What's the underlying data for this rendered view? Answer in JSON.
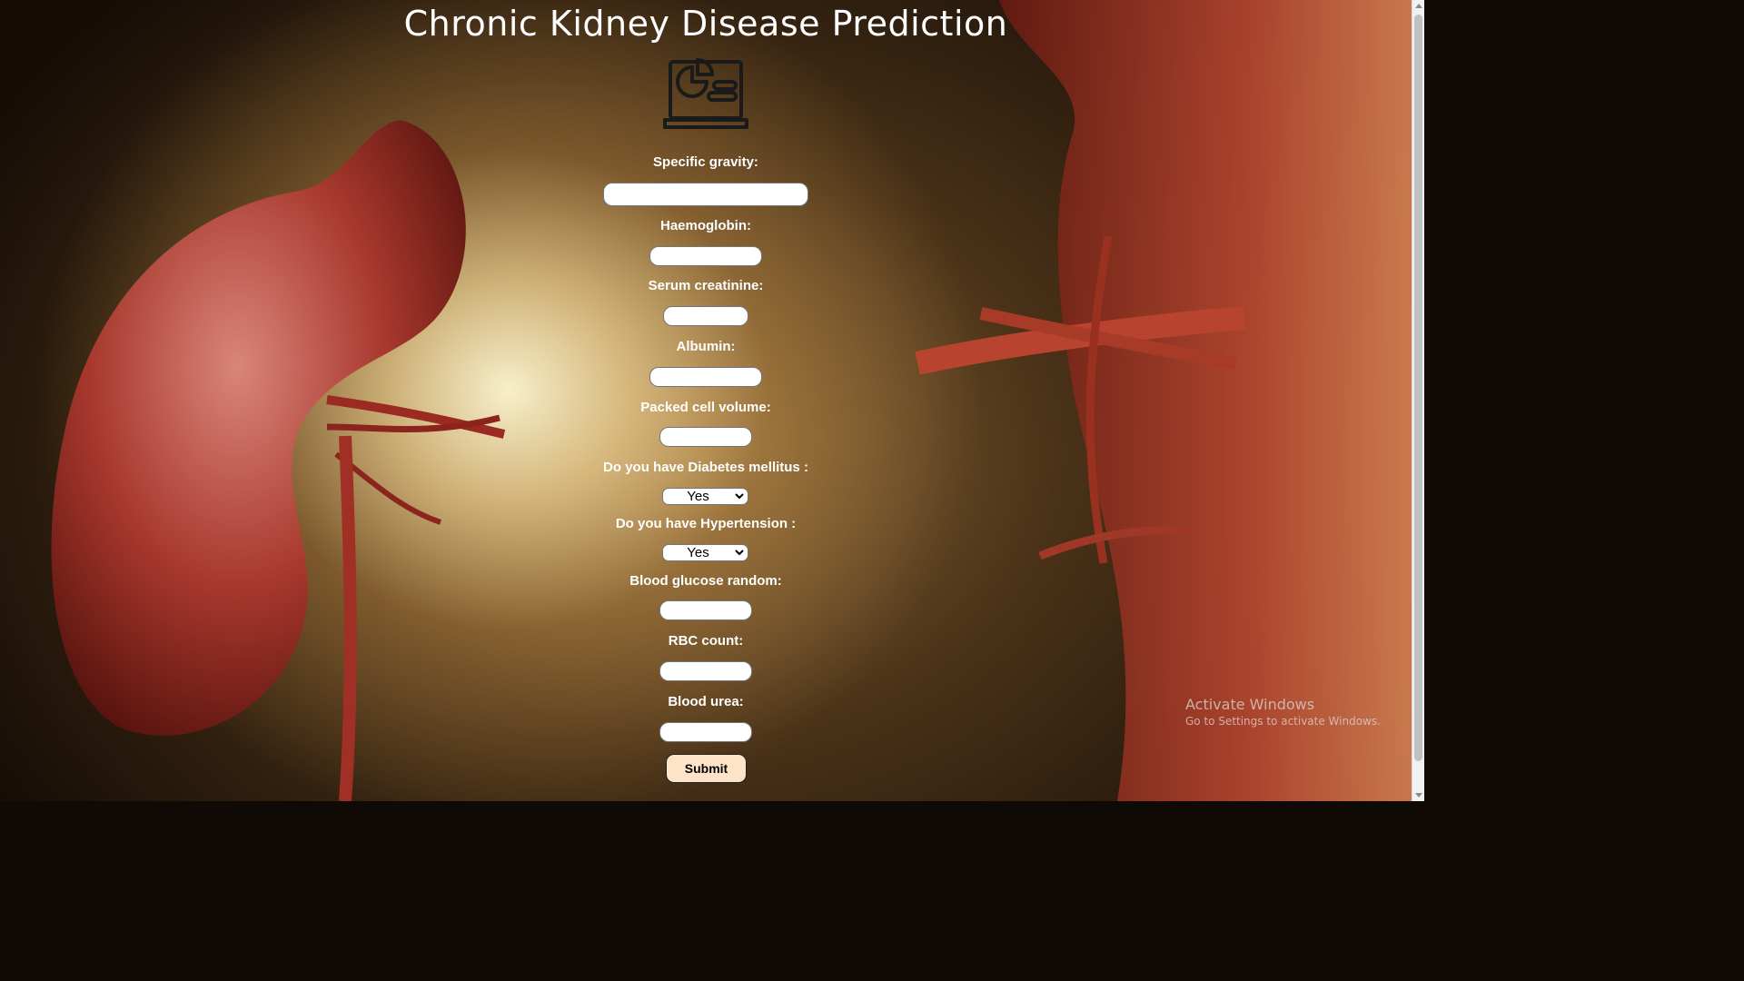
{
  "page": {
    "title": "Chronic Kidney Disease Prediction",
    "logo_icon": "laptop-chart-icon"
  },
  "form": {
    "fields": [
      {
        "label": "Specific gravity:",
        "value": ""
      },
      {
        "label": "Haemoglobin:",
        "value": ""
      },
      {
        "label": "Serum creatinine:",
        "value": ""
      },
      {
        "label": "Albumin:",
        "value": ""
      },
      {
        "label": "Packed cell volume:",
        "value": ""
      },
      {
        "label": "Do you have Diabetes mellitus :",
        "selected": "Yes"
      },
      {
        "label": "Do you have Hypertension :",
        "selected": "Yes"
      },
      {
        "label": "Blood glucose random:",
        "value": ""
      },
      {
        "label": "RBC count:",
        "value": ""
      },
      {
        "label": "Blood urea:",
        "value": ""
      }
    ],
    "submit_label": "Submit"
  },
  "os_watermark": {
    "title": "Activate Windows",
    "subtitle": "Go to Settings to activate Windows."
  },
  "colors": {
    "submit_bg": "#fde4c8",
    "title_text": "#ffffff",
    "kidney": "#a8322a"
  }
}
